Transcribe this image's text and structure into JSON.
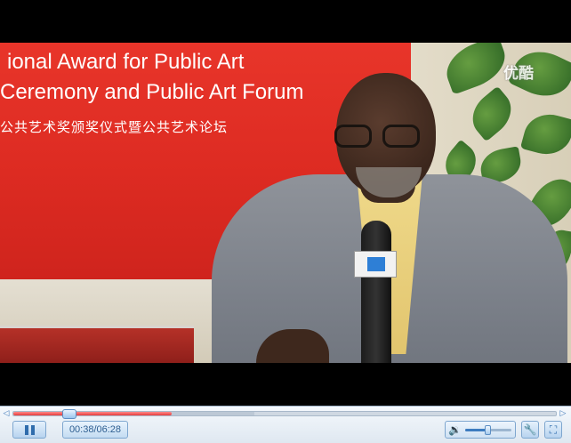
{
  "video": {
    "banner_lines": [
      "ional Award for Public Art",
      "Ceremony and Public Art Forum",
      "公共艺术奖颁奖仪式暨公共艺术论坛"
    ],
    "watermark": "优酷",
    "colors": {
      "banner": "#dd2b22",
      "suit": "#7b8089",
      "shirt": "#e2c56e"
    }
  },
  "player": {
    "seek_arrow_left": "◁",
    "seek_arrow_right": "▷",
    "time_display": "00:38/06:28",
    "played_fraction": 0.104,
    "buffered_fraction": 0.445,
    "volume_fraction": 0.5,
    "icons": {
      "pause": "pause-icon",
      "volume": "speaker-icon",
      "settings": "wrench-icon",
      "fullscreen": "fullscreen-icon"
    },
    "glyphs": {
      "volume": "🔉",
      "settings": "🔧",
      "fullscreen": "⛶"
    },
    "colors": {
      "played": "#e43c3c",
      "accent": "#3d7cc0"
    }
  }
}
